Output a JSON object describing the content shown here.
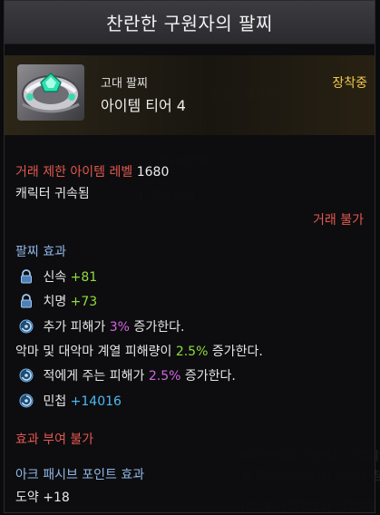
{
  "title": "찬란한 구원자의 팔찌",
  "item": {
    "grade": "고대 팔찌",
    "tier": "아이템 티어 4",
    "equipped": "장착중",
    "icon": "bracelet-icon"
  },
  "trade": {
    "level_label": "거래 제한 아이템 레벨",
    "level_value": "1680",
    "bound": "캐릭터 귀속됨",
    "no_trade": "거래 불가"
  },
  "bracelet_effect": {
    "header": "팔찌 효과",
    "stats": [
      {
        "icon": "lock-icon",
        "name": "신속",
        "value": "+81"
      },
      {
        "icon": "lock-icon",
        "name": "치명",
        "value": "+73"
      }
    ],
    "line1": {
      "icon": "swirl-icon",
      "pre": "추가 피해가 ",
      "pct": "3%",
      "post": " 증가한다."
    },
    "line2": {
      "pre": "악마 및 대악마 계열 피해량이 ",
      "pct": "2.5%",
      "post": " 증가한다."
    },
    "line3": {
      "icon": "swirl-icon",
      "pre": "적에게 주는 피해가 ",
      "pct": "2.5%",
      "post": " 증가한다."
    },
    "line4": {
      "icon": "swirl-icon",
      "name": "민첩",
      "value": "+14016"
    }
  },
  "no_effect": "효과 부여 불가",
  "ark_passive": {
    "header": "아크 패시브 포인트 효과",
    "value": "도약 +18"
  },
  "colors": {
    "red": "#e2584f",
    "green": "#8fdc3d",
    "pink": "#d266e0",
    "cyan": "#4fb8f2",
    "gold": "#f2c94c",
    "section_blue": "#8fb7e6"
  }
}
